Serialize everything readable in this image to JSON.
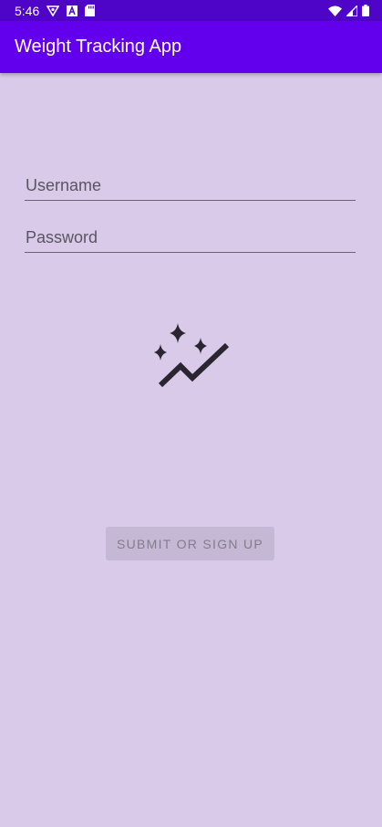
{
  "status_bar": {
    "time": "5:46",
    "icons": [
      "vpn-key-icon",
      "font-a-icon",
      "sd-card-icon",
      "wifi-icon",
      "signal-icon",
      "battery-icon"
    ]
  },
  "app_bar": {
    "title": "Weight Tracking App",
    "color": "#6200EE"
  },
  "form": {
    "username_placeholder": "Username",
    "username_value": "",
    "password_placeholder": "Password",
    "password_value": ""
  },
  "logo": {
    "icon": "sparkle-trend-icon"
  },
  "submit_button": {
    "label": "SUBMIT OR SIGN UP",
    "enabled": false
  },
  "colors": {
    "background": "#D8CAE8",
    "status_bar": "#4F05C8",
    "accent": "#6200EE"
  }
}
